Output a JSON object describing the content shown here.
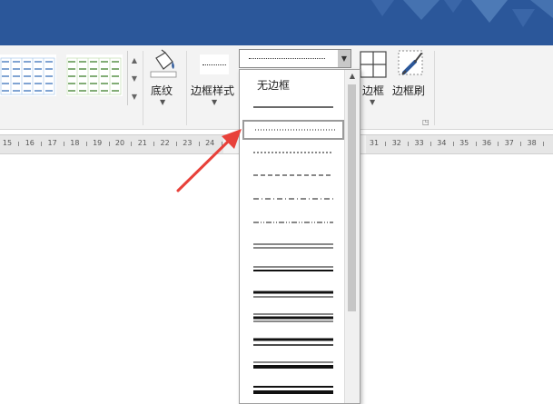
{
  "ribbon": {
    "shading_label": "底纹",
    "border_style_label": "边框样式",
    "borders_label": "边框",
    "border_painter_label": "边框刷"
  },
  "border_style_combo": {
    "current_value": "dotted"
  },
  "border_styles_dropdown": {
    "no_border_label": "无边框",
    "styles": [
      "no-border",
      "single",
      "dotted",
      "fine-dashed",
      "dashed",
      "dash-dot",
      "dash-dot-dot",
      "double",
      "thin-thick",
      "thick-thin",
      "thick-thin-thick",
      "triple-thick",
      "thin-thick-large",
      "thick-double"
    ],
    "selected_index": 2
  },
  "ruler": {
    "left_ticks": [
      "15",
      "16",
      "17",
      "18",
      "19",
      "20",
      "21",
      "22",
      "23",
      "24"
    ],
    "right_ticks": [
      "31",
      "32",
      "33",
      "34",
      "35",
      "36",
      "37",
      "38"
    ]
  },
  "colors": {
    "title_bar": "#2b579a",
    "ribbon": "#f3f3f3",
    "annotation_arrow": "#e8413a"
  }
}
